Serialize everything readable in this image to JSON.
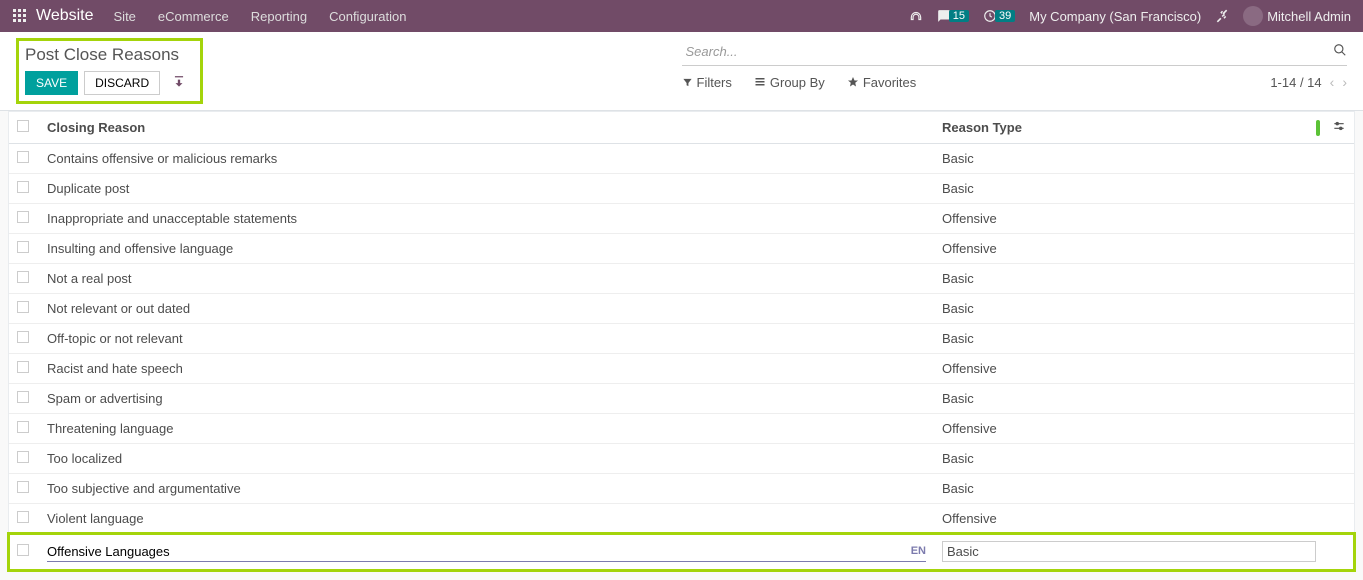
{
  "topnav": {
    "brand": "Website",
    "links": [
      "Site",
      "eCommerce",
      "Reporting",
      "Configuration"
    ],
    "msg_count": "15",
    "clock_count": "39",
    "company": "My Company (San Francisco)",
    "user": "Mitchell Admin"
  },
  "cp": {
    "title": "Post Close Reasons",
    "save": "SAVE",
    "discard": "DISCARD",
    "search_placeholder": "Search...",
    "filters": "Filters",
    "groupby": "Group By",
    "favorites": "Favorites",
    "pager": "1-14 / 14"
  },
  "cols": {
    "reason": "Closing Reason",
    "type": "Reason Type"
  },
  "rows": [
    {
      "reason": "Contains offensive or malicious remarks",
      "type": "Basic"
    },
    {
      "reason": "Duplicate post",
      "type": "Basic"
    },
    {
      "reason": "Inappropriate and unacceptable statements",
      "type": "Offensive"
    },
    {
      "reason": "Insulting and offensive language",
      "type": "Offensive"
    },
    {
      "reason": "Not a real post",
      "type": "Basic"
    },
    {
      "reason": "Not relevant or out dated",
      "type": "Basic"
    },
    {
      "reason": "Off-topic or not relevant",
      "type": "Basic"
    },
    {
      "reason": "Racist and hate speech",
      "type": "Offensive"
    },
    {
      "reason": "Spam or advertising",
      "type": "Basic"
    },
    {
      "reason": "Threatening language",
      "type": "Offensive"
    },
    {
      "reason": "Too localized",
      "type": "Basic"
    },
    {
      "reason": "Too subjective and argumentative",
      "type": "Basic"
    },
    {
      "reason": "Violent language",
      "type": "Offensive"
    }
  ],
  "edit_row": {
    "reason": "Offensive Languages",
    "lang": "EN",
    "type": "Basic"
  }
}
